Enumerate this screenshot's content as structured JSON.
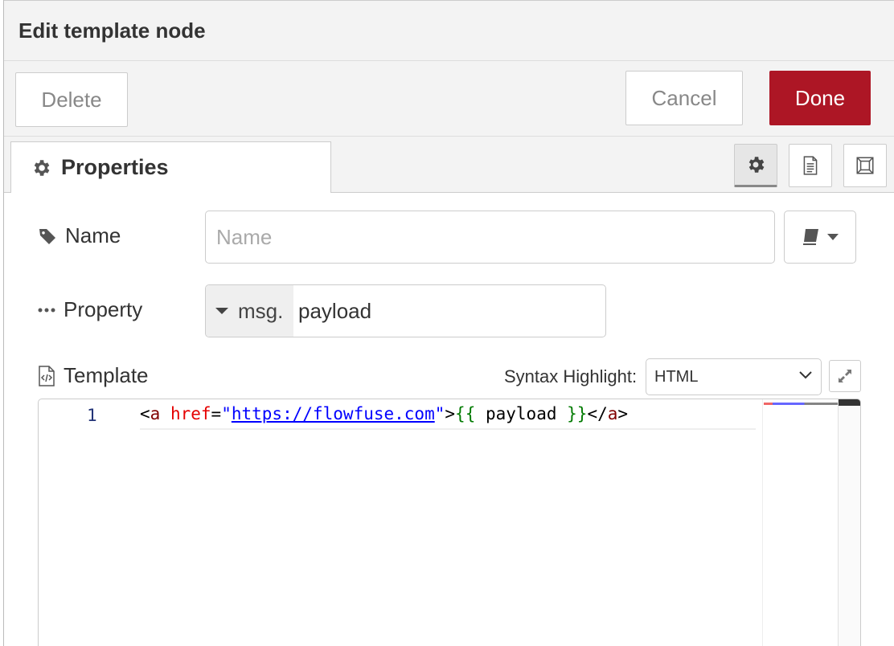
{
  "header": {
    "title": "Edit template node"
  },
  "toolbar": {
    "delete_label": "Delete",
    "cancel_label": "Cancel",
    "done_label": "Done"
  },
  "tabs": {
    "properties_label": "Properties"
  },
  "form": {
    "name_label": "Name",
    "name_placeholder": "Name",
    "property_label": "Property",
    "property_type": "msg.",
    "property_value": "payload",
    "template_label": "Template",
    "syntax_label": "Syntax Highlight:",
    "syntax_value": "HTML"
  },
  "editor": {
    "line_number": "1",
    "code": {
      "t1": "<",
      "t2": "a",
      "t3": " ",
      "t4": "href",
      "t5": "=",
      "t6": "\"",
      "t7": "https://flowfuse.com",
      "t8": "\"",
      "t9": ">",
      "t10": "{{",
      "t11": " payload ",
      "t12": "}}",
      "t13": "</",
      "t14": "a",
      "t15": ">"
    }
  },
  "colors": {
    "done": "#ad1625",
    "header_bg": "#f3f3f3"
  }
}
